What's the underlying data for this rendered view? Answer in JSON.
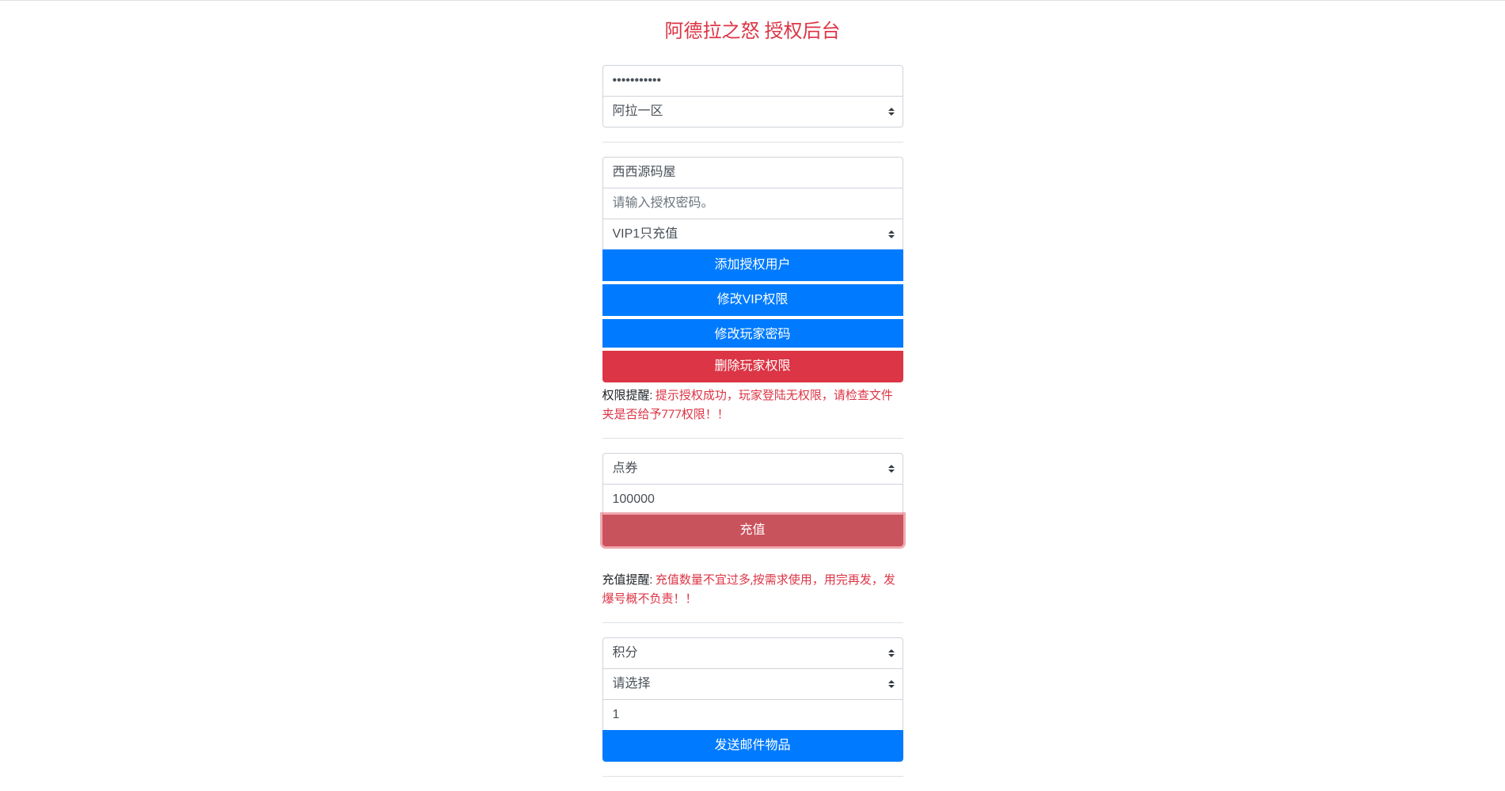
{
  "title": "阿德拉之怒 授权后台",
  "section1": {
    "password_value": "•••••••••••",
    "region_selected": "阿拉一区"
  },
  "section2": {
    "username_value": "西西源码屋",
    "auth_password_placeholder": "请输入授权密码。",
    "vip_selected": "VIP1只充值",
    "btn_add_user": "添加授权用户",
    "btn_modify_vip": "修改VIP权限",
    "btn_modify_password": "修改玩家密码",
    "btn_delete_permission": "删除玩家权限",
    "notice_label": "权限提醒: ",
    "notice_text": "提示授权成功，玩家登陆无权限，请检查文件夹是否给予777权限！！"
  },
  "section3": {
    "currency_selected": "点券",
    "amount_value": "100000",
    "btn_recharge": "充值",
    "notice_label": "充值提醒: ",
    "notice_text": "充值数量不宜过多,按需求使用，用完再发，发爆号概不负责！！"
  },
  "section4": {
    "reward_type_selected": "积分",
    "reward_option_selected": "请选择",
    "reward_amount_value": "1",
    "btn_send_mail": "发送邮件物品"
  }
}
